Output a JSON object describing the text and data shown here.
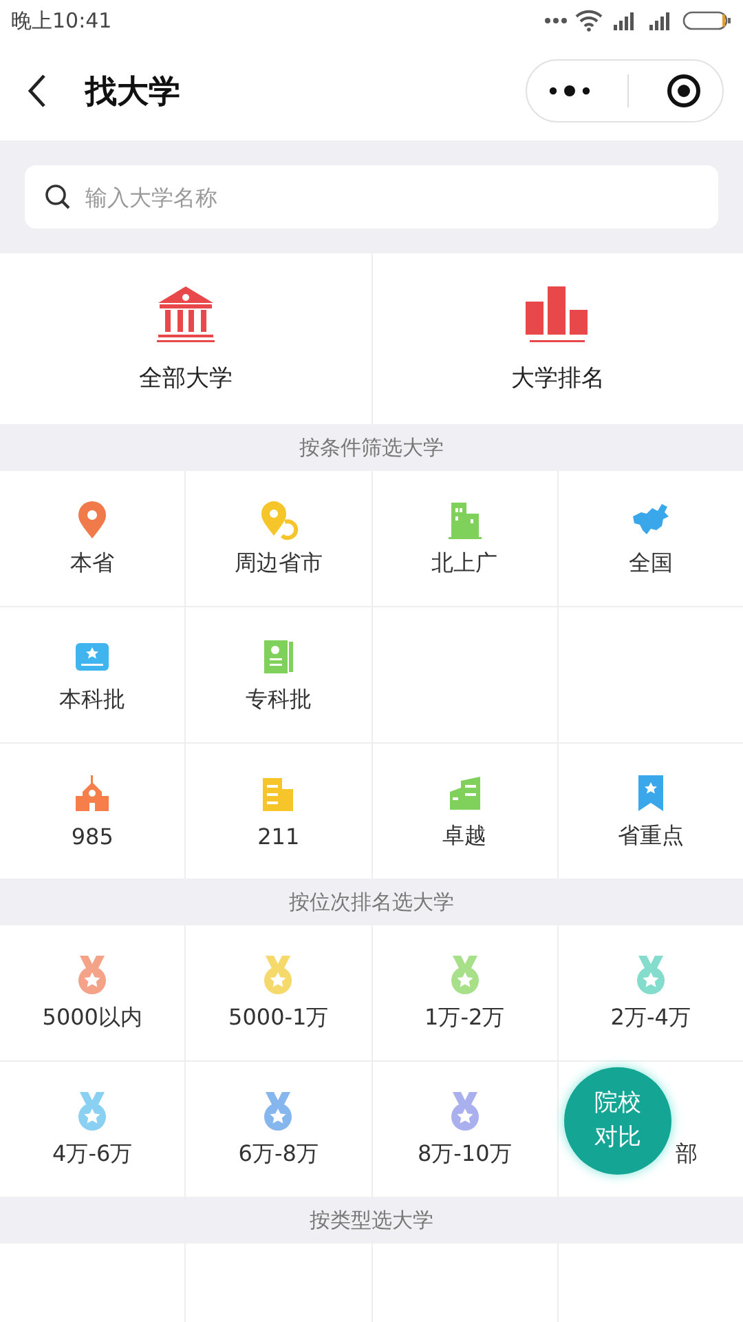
{
  "status_bar": {
    "time": "晚上10:41"
  },
  "nav": {
    "title": "找大学"
  },
  "search": {
    "placeholder": "输入大学名称"
  },
  "top_entries": [
    {
      "label": "全部大学",
      "kind": "building"
    },
    {
      "label": "大学排名",
      "kind": "podium"
    }
  ],
  "sections": [
    {
      "title": "按条件筛选大学",
      "rows": [
        [
          {
            "label": "本省",
            "kind": "pin",
            "color": "#f07a4a"
          },
          {
            "label": "周边省市",
            "kind": "pins",
            "color": "#f5c52a"
          },
          {
            "label": "北上广",
            "kind": "towers",
            "color": "#7fd15b"
          },
          {
            "label": "全国",
            "kind": "map",
            "color": "#3aa7ea"
          }
        ],
        [
          {
            "label": "本科批",
            "kind": "card",
            "color": "#3fb4ef"
          },
          {
            "label": "专科批",
            "kind": "book",
            "color": "#7fd15b"
          }
        ],
        [
          {
            "label": "985",
            "kind": "school",
            "color": "#f57e4a"
          },
          {
            "label": "211",
            "kind": "office",
            "color": "#f5c52a"
          },
          {
            "label": "卓越",
            "kind": "blocks",
            "color": "#7fd15b"
          },
          {
            "label": "省重点",
            "kind": "bookmark",
            "color": "#3aa7ea"
          }
        ]
      ]
    },
    {
      "title": "按位次排名选大学",
      "rows": [
        [
          {
            "label": "5000以内",
            "kind": "medal",
            "color": "#f5a388"
          },
          {
            "label": "5000-1万",
            "kind": "medal",
            "color": "#f5d96a"
          },
          {
            "label": "1万-2万",
            "kind": "medal",
            "color": "#a8e08a"
          },
          {
            "label": "2万-4万",
            "kind": "medal",
            "color": "#84dccc"
          }
        ],
        [
          {
            "label": "4万-6万",
            "kind": "medal",
            "color": "#8ad0f2"
          },
          {
            "label": "6万-8万",
            "kind": "medal",
            "color": "#86b6ee"
          },
          {
            "label": "8万-10万",
            "kind": "medal",
            "color": "#aab0ee"
          },
          {
            "label": "部",
            "covered": true
          }
        ]
      ]
    },
    {
      "title": "按类型选大学",
      "rows": [
        []
      ]
    }
  ],
  "float_button": {
    "label": "院校对比"
  }
}
